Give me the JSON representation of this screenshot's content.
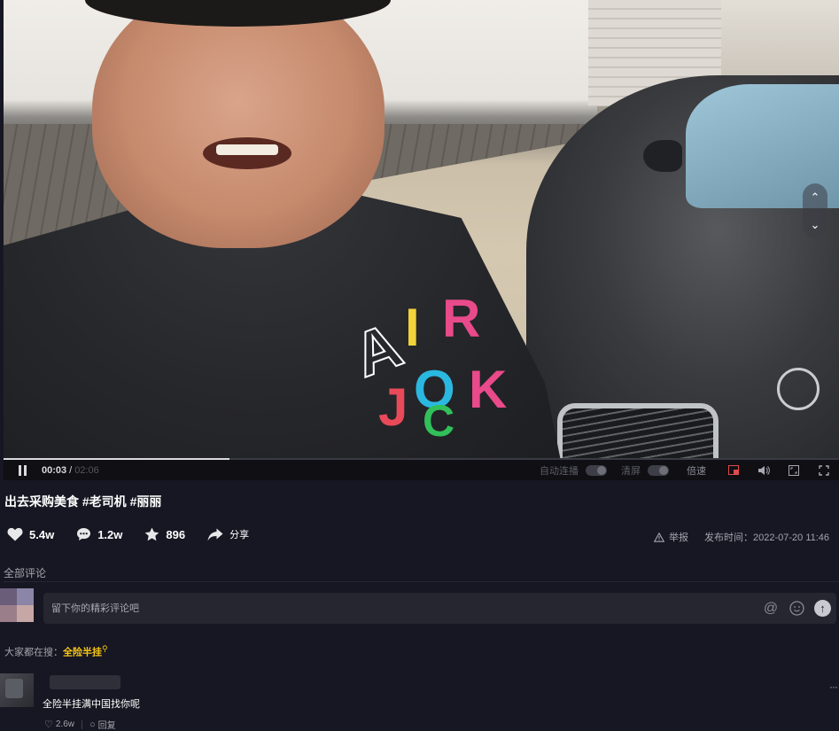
{
  "video": {
    "player": {
      "current_time": "00:03",
      "time_separator": "/",
      "duration": "02:06",
      "progress": 0.27,
      "autoplay_label": "自动连播",
      "clear_label": "清屏",
      "speed_label": "倍速",
      "shirt_print": [
        "A",
        "I",
        "R",
        "J",
        "O",
        "C",
        "K"
      ]
    }
  },
  "post": {
    "title": "出去采购美食 #老司机 #丽丽",
    "likes": "5.4w",
    "comments": "1.2w",
    "favorites": "896",
    "share_label": "分享",
    "report_label": "举报",
    "publish_label": "发布时间：2022-07-20 11:46"
  },
  "comments": {
    "heading": "全部评论",
    "input_placeholder": "留下你的精彩评论吧",
    "trending_prefix": "大家都在搜：",
    "trending_term": "全险半挂",
    "items": [
      {
        "text": "全险半挂满中国找你呢",
        "likes": "2.6w",
        "reply_label": "回复",
        "more": "···"
      }
    ]
  },
  "colors": {
    "background": "#161722",
    "accent_yellow": "#f5c518",
    "input_bg": "#25262f"
  }
}
